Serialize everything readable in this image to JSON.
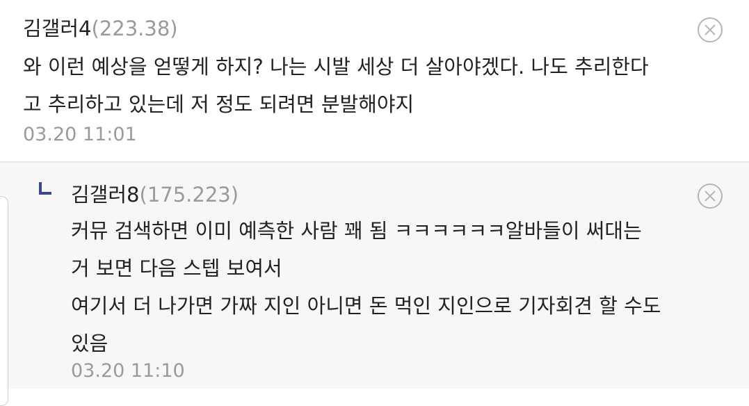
{
  "comment": {
    "nickname": "김갤러4",
    "ip": "(223.38)",
    "lines": [
      "와 이런 예상을 얻떻게 하지? 나는 시발 세상 더 살아야겠다. 나도 추리한다",
      "고 추리하고 있는데 저 정도 되려면 분발해야지"
    ],
    "date": "03.20 11:01",
    "delete_icon": "close-circle-icon"
  },
  "reply": {
    "nickname": "김갤러8",
    "ip": "(175.223)",
    "lines": [
      "커뮤 검색하면 이미 예측한 사람 꽤 됨 ㅋㅋㅋㅋㅋㅋ알바들이 써대는",
      "거 보면 다음 스텝 보여서",
      "여기서 더 나가면 가짜 지인 아니면 돈 먹인 지인으로 기자회견 할 수도",
      "있음"
    ],
    "date": "03.20 11:10",
    "reply_icon": "reply-arrow-icon",
    "delete_icon": "close-circle-icon"
  },
  "colors": {
    "text": "#222222",
    "muted": "#9a9a9a",
    "reply_bg": "#f7f7f7",
    "reply_mark": "#3b4890",
    "divider": "#e6e6e6"
  }
}
